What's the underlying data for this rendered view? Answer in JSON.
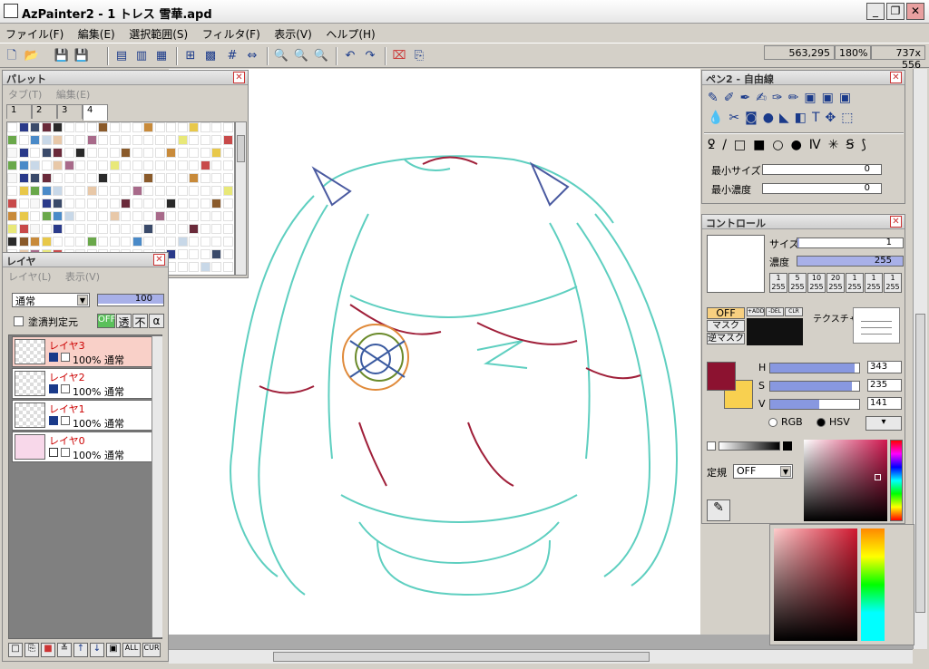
{
  "window": {
    "title": "AzPainter2 - 1 トレス 雪華.apd",
    "buttons": [
      "_",
      "❐",
      "✕"
    ]
  },
  "menu": [
    "ファイル(F)",
    "編集(E)",
    "選択範囲(S)",
    "フィルタ(F)",
    "表示(V)",
    "ヘルプ(H)"
  ],
  "status": {
    "coords": "563,295",
    "zoom": "180%",
    "size": "737x 556"
  },
  "palette": {
    "title": "パレット",
    "menu": [
      "タブ(T)",
      "編集(E)"
    ],
    "tabs": [
      "1",
      "2",
      "3",
      "4"
    ],
    "active_tab": "4"
  },
  "layers": {
    "title": "レイヤ",
    "menu": [
      "レイヤ(L)",
      "表示(V)"
    ],
    "blend_mode": "通常",
    "opacity": "100",
    "option_label": "塗潰判定元",
    "flag_buttons": [
      "OFF",
      "透",
      "不",
      "α"
    ],
    "items": [
      {
        "name": "レイヤ3",
        "info": "100% 通常",
        "selected": true
      },
      {
        "name": "レイヤ2",
        "info": "100% 通常",
        "selected": false
      },
      {
        "name": "レイヤ1",
        "info": "100% 通常",
        "selected": false
      },
      {
        "name": "レイヤ0",
        "info": "100% 通常",
        "selected": false
      }
    ],
    "bottom_buttons": [
      "ALL",
      "CUR"
    ]
  },
  "pen": {
    "title": "ペン2 - 自由線",
    "min_size_label": "最小サイズ",
    "min_size_value": "0",
    "min_density_label": "最小濃度",
    "min_density_value": "0"
  },
  "control": {
    "title": "コントロール",
    "size_label": "サイズ",
    "size_value": "1",
    "density_label": "濃度",
    "density_value": "255",
    "presets": [
      [
        "1",
        "255"
      ],
      [
        "5",
        "255"
      ],
      [
        "10",
        "255"
      ],
      [
        "20",
        "255"
      ],
      [
        "1",
        "255"
      ],
      [
        "1",
        "255"
      ],
      [
        "1",
        "255"
      ]
    ],
    "mask_off": "OFF",
    "mask": "マスク",
    "reverse_mask": "逆マスク",
    "mask_btns": [
      "+ADD",
      "-DEL",
      "CLR"
    ],
    "texture_label": "テクスチャ",
    "h_label": "H",
    "h_value": "343",
    "s_label": "S",
    "s_value": "235",
    "v_label": "V",
    "v_value": "141",
    "rgb_label": "RGB",
    "hsv_label": "HSV",
    "teiki_label": "定規",
    "teiki_value": "OFF",
    "fg_color": "#8c1230",
    "bg_color": "#f8d050"
  }
}
